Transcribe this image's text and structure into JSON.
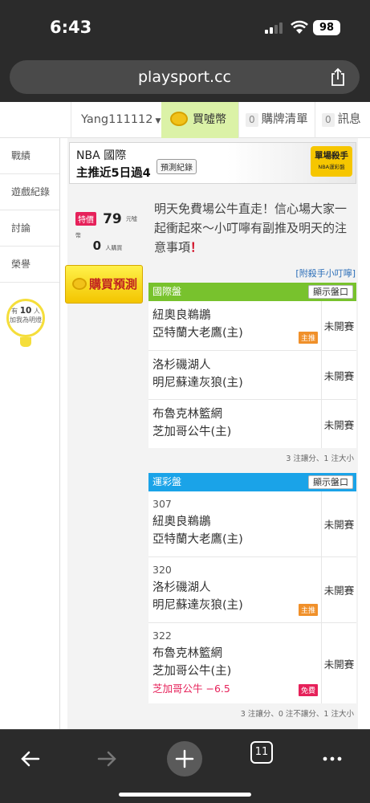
{
  "status": {
    "time": "6:43",
    "battery": "98"
  },
  "browser": {
    "url": "playsport.cc",
    "tab_count": "11"
  },
  "header": {
    "username": "Yang111112",
    "buy_coin_label": "買噓幣",
    "cart_count": "0",
    "cart_label": "購牌清單",
    "msg_count": "0",
    "msg_label": "訊息"
  },
  "sidebar": {
    "items": [
      {
        "label": "戰績"
      },
      {
        "label": "遊戲紀錄"
      },
      {
        "label": "討論"
      },
      {
        "label": "榮譽"
      }
    ],
    "bright_prefix": "有",
    "bright_count": "10",
    "bright_suffix": "人",
    "bright_text": "加我為明燈"
  },
  "banner": {
    "title": "NBA 國際",
    "subtitle": "主推近5日過4",
    "record_button": "預測紀錄",
    "badge_title": "單場殺手",
    "badge_sub": "NBA運彩盤"
  },
  "prediction": {
    "special_label": "特價",
    "price": "79",
    "price_unit": "元噓幣",
    "buyers": "0",
    "buyers_unit": "人購買",
    "buy_button": "購買預測",
    "analysis": "明天免費場公牛直走！信心場大家一起衝起來～小叮嚀有副推及明天的注意事項",
    "analysis_mark": "！",
    "attach_link": "[附殺手小叮嚀]"
  },
  "intl_panel": {
    "title": "國際盤",
    "show_button": "顯示盤口",
    "rows": [
      {
        "away": "紐奧良鵜鶘",
        "home": "亞特蘭大老鷹(主)",
        "tag": "主推",
        "status": "未開賽"
      },
      {
        "away": "洛杉磯湖人",
        "home": "明尼蘇達灰狼(主)",
        "status": "未開賽"
      },
      {
        "away": "布魯克林籃網",
        "home": "芝加哥公牛(主)",
        "status": "未開賽"
      }
    ],
    "footer": "3 注讓分、1 注大小"
  },
  "lottery_panel": {
    "title": "運彩盤",
    "show_button": "顯示盤口",
    "rows": [
      {
        "num": "307",
        "away": "紐奧良鵜鶘",
        "home": "亞特蘭大老鷹(主)",
        "status": "未開賽"
      },
      {
        "num": "320",
        "away": "洛杉磯湖人",
        "home": "明尼蘇達灰狼(主)",
        "tag": "主推",
        "status": "未開賽"
      },
      {
        "num": "322",
        "away": "布魯克林籃網",
        "home": "芝加哥公牛(主)",
        "pick": "芝加哥公牛 −6.5",
        "tag": "免費",
        "status": "未開賽"
      }
    ],
    "footer": "3 注讓分、0 注不讓分、1 注大小"
  },
  "colors": {
    "intl_header": "#78c22d",
    "lottery_header": "#1aa3e8",
    "special": "#e6215a",
    "main_tag": "#f0902a"
  },
  "icons": [
    "signal-icon",
    "wifi-icon",
    "share-icon",
    "coin-icon",
    "bulb-icon",
    "back-icon",
    "forward-icon",
    "plus-icon",
    "tabs-icon",
    "more-icon"
  ]
}
